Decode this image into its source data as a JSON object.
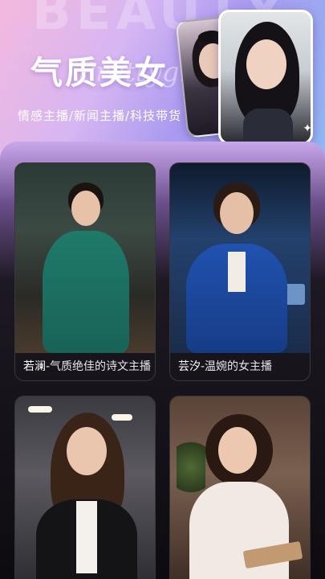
{
  "hero": {
    "watermark": "BEAUTY",
    "script_text": "Prettygirl",
    "title": "气质美女",
    "subtitle": "情感主播/新闻主播/科技带货",
    "sparkle_icon": "sparkle-icon"
  },
  "cards": [
    {
      "name": "若澜",
      "desc": "-气质绝佳的诗文主播"
    },
    {
      "name": "芸汐",
      "desc": "-温婉的女主播"
    },
    {
      "name": "",
      "desc": ""
    },
    {
      "name": "",
      "desc": ""
    }
  ]
}
